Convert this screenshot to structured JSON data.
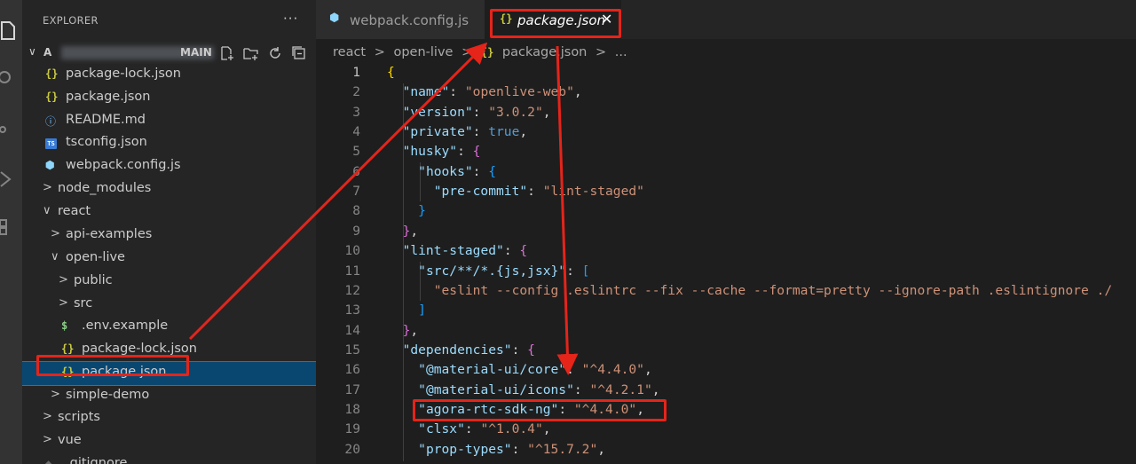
{
  "explorer": {
    "title": "EXPLORER",
    "more_label": "···",
    "workspace_name": "MAIN",
    "tree": [
      {
        "label": "package-lock.json",
        "icon": "{}",
        "kind": "json",
        "indent": 0
      },
      {
        "label": "package.json",
        "icon": "{}",
        "kind": "json",
        "indent": 0
      },
      {
        "label": "README.md",
        "icon": "ⓘ",
        "kind": "info",
        "indent": 0
      },
      {
        "label": "tsconfig.json",
        "icon": "TS",
        "kind": "ts",
        "indent": 0
      },
      {
        "label": "webpack.config.js",
        "icon": "⬢",
        "kind": "webpack",
        "indent": 0
      },
      {
        "label": "node_modules",
        "kind": "folder-closed",
        "indent": 0
      },
      {
        "label": "react",
        "kind": "folder-open",
        "indent": 0
      },
      {
        "label": "api-examples",
        "kind": "folder-closed",
        "indent": 1
      },
      {
        "label": "open-live",
        "kind": "folder-open",
        "indent": 1
      },
      {
        "label": "public",
        "kind": "folder-closed",
        "indent": 2
      },
      {
        "label": "src",
        "kind": "folder-closed",
        "indent": 2
      },
      {
        "label": ".env.example",
        "icon": "$",
        "kind": "dollar",
        "indent": 2
      },
      {
        "label": "package-lock.json",
        "icon": "{}",
        "kind": "json",
        "indent": 2
      },
      {
        "label": "package.json",
        "icon": "{}",
        "kind": "json",
        "indent": 2,
        "selected": true
      },
      {
        "label": "simple-demo",
        "kind": "folder-closed",
        "indent": 1
      },
      {
        "label": "scripts",
        "kind": "folder-closed",
        "indent": 0
      },
      {
        "label": "vue",
        "kind": "folder-closed",
        "indent": 0
      },
      {
        "label": ".gitignore",
        "icon": "◆",
        "kind": "git",
        "indent": 0
      }
    ]
  },
  "tabs": {
    "inactive_label": "webpack.config.js",
    "active_label": "package.json",
    "active_icon": "{}",
    "close_glyph": "✕"
  },
  "breadcrumb": {
    "parts": [
      "react",
      "open-live",
      "package.json",
      "..."
    ],
    "separator": ">"
  },
  "editor": {
    "lines": [
      {
        "n": "1",
        "tokens": [
          [
            "{",
            "b1"
          ]
        ],
        "current": true
      },
      {
        "n": "2",
        "tokens": [
          [
            "  ",
            ""
          ],
          [
            "\"name\"",
            "key"
          ],
          [
            ": ",
            "p"
          ],
          [
            "\"openlive-web\"",
            "str"
          ],
          [
            ",",
            "p"
          ]
        ]
      },
      {
        "n": "3",
        "tokens": [
          [
            "  ",
            ""
          ],
          [
            "\"version\"",
            "key"
          ],
          [
            ": ",
            "p"
          ],
          [
            "\"3.0.2\"",
            "str"
          ],
          [
            ",",
            "p"
          ]
        ]
      },
      {
        "n": "4",
        "tokens": [
          [
            "  ",
            ""
          ],
          [
            "\"private\"",
            "key"
          ],
          [
            ": ",
            "p"
          ],
          [
            "true",
            "bool"
          ],
          [
            ",",
            "p"
          ]
        ]
      },
      {
        "n": "5",
        "tokens": [
          [
            "  ",
            ""
          ],
          [
            "\"husky\"",
            "key"
          ],
          [
            ": ",
            "p"
          ],
          [
            "{",
            "b2"
          ]
        ]
      },
      {
        "n": "6",
        "tokens": [
          [
            "    ",
            ""
          ],
          [
            "\"hooks\"",
            "key"
          ],
          [
            ": ",
            "p"
          ],
          [
            "{",
            "b3"
          ]
        ]
      },
      {
        "n": "7",
        "tokens": [
          [
            "      ",
            ""
          ],
          [
            "\"pre-commit\"",
            "key"
          ],
          [
            ": ",
            "p"
          ],
          [
            "\"lint-staged\"",
            "str"
          ]
        ]
      },
      {
        "n": "8",
        "tokens": [
          [
            "    ",
            ""
          ],
          [
            "}",
            "b3"
          ]
        ]
      },
      {
        "n": "9",
        "tokens": [
          [
            "  ",
            ""
          ],
          [
            "}",
            "b2"
          ],
          [
            ",",
            "p"
          ]
        ]
      },
      {
        "n": "10",
        "tokens": [
          [
            "  ",
            ""
          ],
          [
            "\"lint-staged\"",
            "key"
          ],
          [
            ": ",
            "p"
          ],
          [
            "{",
            "b2"
          ]
        ]
      },
      {
        "n": "11",
        "tokens": [
          [
            "    ",
            ""
          ],
          [
            "\"src/**/*.{js,jsx}\"",
            "key"
          ],
          [
            ": ",
            "p"
          ],
          [
            "[",
            "b3"
          ]
        ]
      },
      {
        "n": "12",
        "tokens": [
          [
            "      ",
            ""
          ],
          [
            "\"eslint --config .eslintrc --fix --cache --format=pretty --ignore-path .eslintignore ./",
            "str"
          ]
        ]
      },
      {
        "n": "13",
        "tokens": [
          [
            "    ",
            ""
          ],
          [
            "]",
            "b3"
          ]
        ]
      },
      {
        "n": "14",
        "tokens": [
          [
            "  ",
            ""
          ],
          [
            "}",
            "b2"
          ],
          [
            ",",
            "p"
          ]
        ]
      },
      {
        "n": "15",
        "tokens": [
          [
            "  ",
            ""
          ],
          [
            "\"dependencies\"",
            "key"
          ],
          [
            ": ",
            "p"
          ],
          [
            "{",
            "b2"
          ]
        ]
      },
      {
        "n": "16",
        "tokens": [
          [
            "    ",
            ""
          ],
          [
            "\"@material-ui/core\"",
            "key"
          ],
          [
            ": ",
            "p"
          ],
          [
            "\"^4.4.0\"",
            "str"
          ],
          [
            ",",
            "p"
          ]
        ]
      },
      {
        "n": "17",
        "tokens": [
          [
            "    ",
            ""
          ],
          [
            "\"@material-ui/icons\"",
            "key"
          ],
          [
            ": ",
            "p"
          ],
          [
            "\"^4.2.1\"",
            "str"
          ],
          [
            ",",
            "p"
          ]
        ]
      },
      {
        "n": "18",
        "tokens": [
          [
            "    ",
            ""
          ],
          [
            "\"agora-rtc-sdk-ng\"",
            "key"
          ],
          [
            ": ",
            "p"
          ],
          [
            "\"^4.4.0\"",
            "str"
          ],
          [
            ",",
            "p"
          ]
        ]
      },
      {
        "n": "19",
        "tokens": [
          [
            "    ",
            ""
          ],
          [
            "\"clsx\"",
            "key"
          ],
          [
            ": ",
            "p"
          ],
          [
            "\"^1.0.4\"",
            "str"
          ],
          [
            ",",
            "p"
          ]
        ]
      },
      {
        "n": "20",
        "tokens": [
          [
            "    ",
            ""
          ],
          [
            "\"prop-types\"",
            "key"
          ],
          [
            ": ",
            "p"
          ],
          [
            "\"^15.7.2\"",
            "str"
          ],
          [
            ",",
            "p"
          ]
        ]
      }
    ]
  },
  "colors": {
    "annotation": "#e5241a",
    "selection": "#094771",
    "json_icon": "#cbcb41"
  }
}
